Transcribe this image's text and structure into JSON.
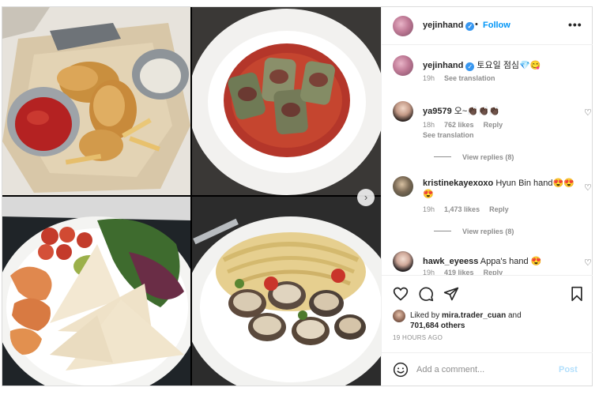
{
  "post": {
    "author": "yejinhand",
    "follow_label": "Follow",
    "header_dot": "•",
    "more_label": "•••"
  },
  "caption": {
    "username": "yejinhand",
    "text": " 토요일 점심💎😋",
    "time": "19h",
    "see_translation": "See translation"
  },
  "comments": [
    {
      "username": "ya9579",
      "text": " 오~👏🏿👏🏿👏🏿",
      "time": "18h",
      "likes": "762 likes",
      "reply_label": "Reply",
      "see_translation": "See translation",
      "view_replies": "View replies (8)"
    },
    {
      "username": "kristinekayexoxo",
      "text": " Hyun Bin hand😍😍😍",
      "time": "19h",
      "likes": "1,473 likes",
      "reply_label": "Reply",
      "view_replies": "View replies (8)"
    },
    {
      "username": "hawk_eyeess",
      "text": " Appa's hand 😍",
      "time": "19h",
      "likes": "419 likes",
      "reply_label": "Reply"
    }
  ],
  "likes": {
    "liked_by_prefix": "Liked by ",
    "liked_by_user": "mira.trader_cuan",
    "and_label": " and",
    "others": "701,684 others"
  },
  "timestamp": "19 HOURS AGO",
  "composer": {
    "placeholder": "Add a comment...",
    "post_label": "Post"
  },
  "icons": {
    "verified": "verified-badge-icon",
    "next": "chevron-right-icon",
    "like": "heart-icon",
    "comment": "comment-icon",
    "share": "paper-plane-icon",
    "save": "bookmark-icon",
    "emoji": "smiley-icon"
  },
  "colors": {
    "accent": "#0095f6",
    "verified": "#3897f0",
    "muted": "#8e8e8e",
    "post_disabled": "#b2dffc"
  }
}
